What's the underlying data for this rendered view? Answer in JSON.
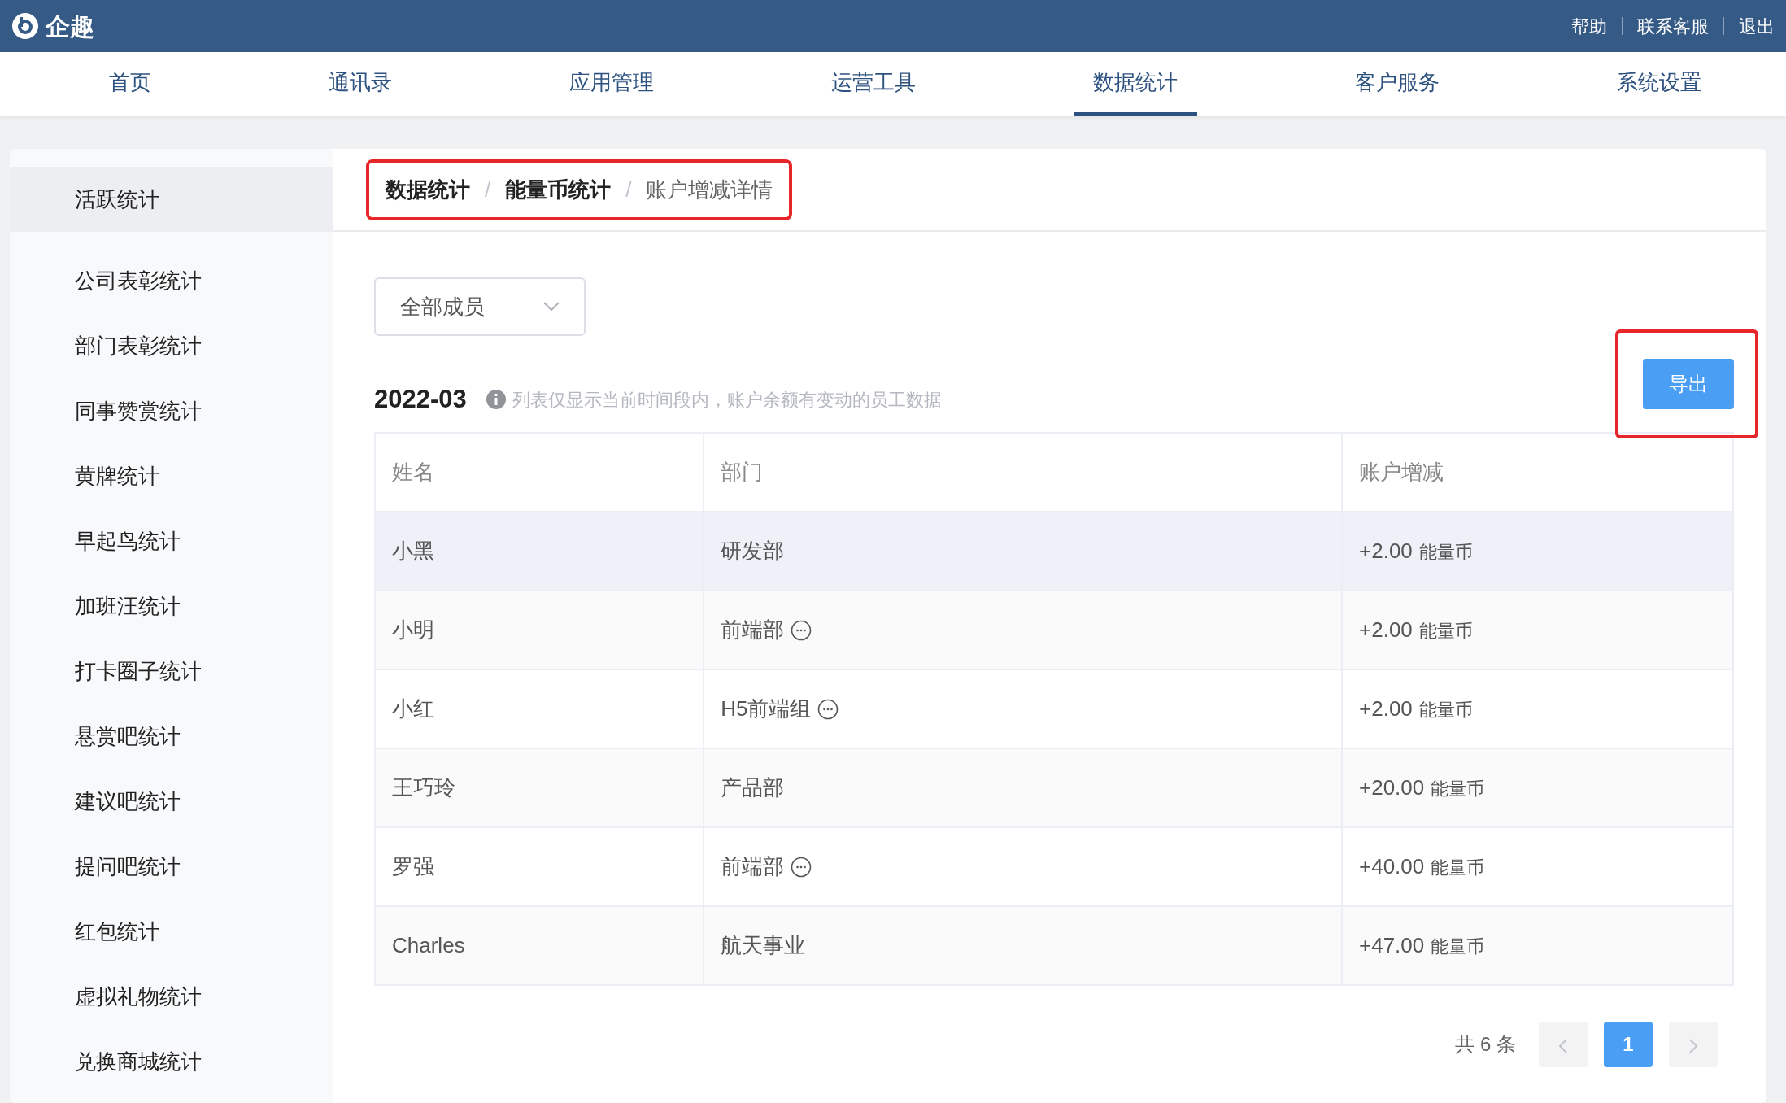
{
  "header": {
    "brand": "企趣",
    "links": [
      "帮助",
      "联系客服",
      "退出"
    ]
  },
  "nav": [
    {
      "label": "首页",
      "selected": false
    },
    {
      "label": "通讯录",
      "selected": false
    },
    {
      "label": "应用管理",
      "selected": false
    },
    {
      "label": "运营工具",
      "selected": false
    },
    {
      "label": "数据统计",
      "selected": true
    },
    {
      "label": "客户服务",
      "selected": false
    },
    {
      "label": "系统设置",
      "selected": false
    }
  ],
  "sidebar": {
    "items": [
      {
        "label": "活跃统计",
        "selected": true
      },
      {
        "label": "公司表彰统计",
        "selected": false
      },
      {
        "label": "部门表彰统计",
        "selected": false
      },
      {
        "label": "同事赞赏统计",
        "selected": false
      },
      {
        "label": "黄牌统计",
        "selected": false
      },
      {
        "label": "早起鸟统计",
        "selected": false
      },
      {
        "label": "加班汪统计",
        "selected": false
      },
      {
        "label": "打卡圈子统计",
        "selected": false
      },
      {
        "label": "悬赏吧统计",
        "selected": false
      },
      {
        "label": "建议吧统计",
        "selected": false
      },
      {
        "label": "提问吧统计",
        "selected": false
      },
      {
        "label": "红包统计",
        "selected": false
      },
      {
        "label": "虚拟礼物统计",
        "selected": false
      },
      {
        "label": "兑换商城统计",
        "selected": false
      }
    ]
  },
  "breadcrumb": {
    "highlighted": true,
    "separator": "/",
    "items": [
      {
        "label": "数据统计",
        "current": false
      },
      {
        "label": "能量币统计",
        "current": false
      },
      {
        "label": "账户增减详情",
        "current": true
      }
    ]
  },
  "filter": {
    "value": "全部成员"
  },
  "period": "2022-03",
  "hint": "列表仅显示当前时间段内，账户余额有变动的员工数据",
  "export_button": {
    "label": "导出",
    "highlighted": true
  },
  "table": {
    "columns": [
      "姓名",
      "部门",
      "账户增减"
    ],
    "rows": [
      {
        "name": "小黑",
        "department": "研发部",
        "more": false,
        "amount": "+2.00",
        "unit": "能量币",
        "hovered": true
      },
      {
        "name": "小明",
        "department": "前端部",
        "more": true,
        "amount": "+2.00",
        "unit": "能量币",
        "hovered": false
      },
      {
        "name": "小红",
        "department": "H5前端组",
        "more": true,
        "amount": "+2.00",
        "unit": "能量币",
        "hovered": false
      },
      {
        "name": "王巧玲",
        "department": "产品部",
        "more": false,
        "amount": "+20.00",
        "unit": "能量币",
        "hovered": false
      },
      {
        "name": "罗强",
        "department": "前端部",
        "more": true,
        "amount": "+40.00",
        "unit": "能量币",
        "hovered": false
      },
      {
        "name": "Charles",
        "department": "航天事业",
        "more": false,
        "amount": "+47.00",
        "unit": "能量币",
        "hovered": false
      }
    ]
  },
  "pagination": {
    "total": "共 6 条",
    "pages": [
      {
        "label": "1",
        "selected": true
      }
    ]
  }
}
